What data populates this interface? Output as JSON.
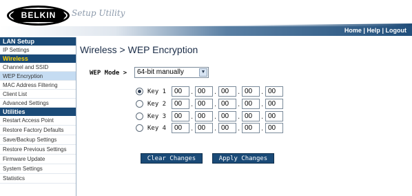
{
  "header": {
    "brand": "BELKIN",
    "product": "Setup Utility",
    "links": [
      "Home",
      "Help",
      "Logout"
    ],
    "separator": "|"
  },
  "sidebar": {
    "sections": [
      {
        "title": "LAN Setup",
        "items": [
          "IP Settings"
        ]
      },
      {
        "title": "Wireless",
        "items": [
          "Channel and SSID",
          "WEP Encryption",
          "MAC Address Filtering",
          "Client List",
          "Advanced Settings"
        ]
      },
      {
        "title": "Utilities",
        "items": [
          "Restart Access Point",
          "Restore Factory Defaults",
          "Save/Backup Settings",
          "Restore Previous Settings",
          "Firmware Update",
          "System Settings",
          "Statistics"
        ]
      }
    ],
    "active": "WEP Encryption"
  },
  "main": {
    "title": "Wireless > WEP Encryption",
    "wep_mode_label": "WEP Mode >",
    "wep_mode_value": "64-bit manually",
    "keys": [
      {
        "label": "Key 1",
        "selected": true,
        "values": [
          "00",
          "00",
          "00",
          "00",
          "00"
        ]
      },
      {
        "label": "Key 2",
        "selected": false,
        "values": [
          "00",
          "00",
          "00",
          "00",
          "00"
        ]
      },
      {
        "label": "Key 3",
        "selected": false,
        "values": [
          "00",
          "00",
          "00",
          "00",
          "00"
        ]
      },
      {
        "label": "Key 4",
        "selected": false,
        "values": [
          "00",
          "00",
          "00",
          "00",
          "00"
        ]
      }
    ],
    "clear_label": "Clear Changes",
    "apply_label": "Apply Changes"
  }
}
